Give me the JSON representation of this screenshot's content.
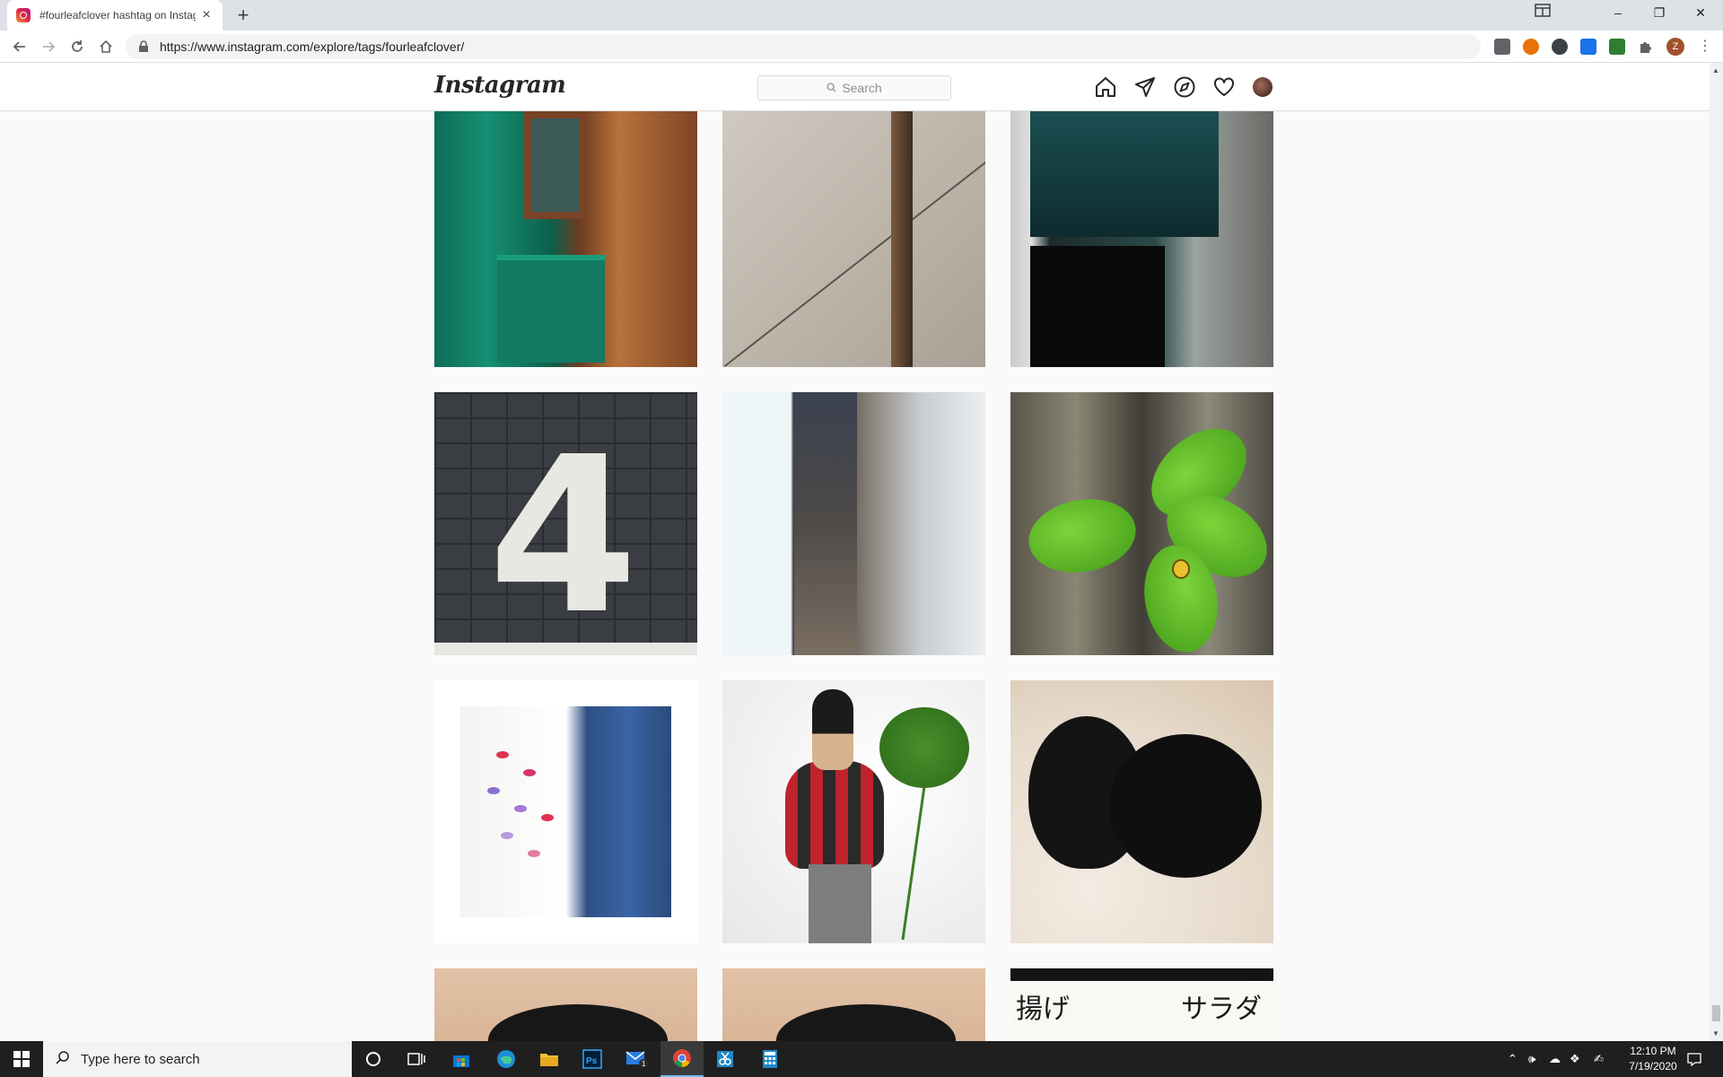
{
  "browser": {
    "tab_title": "#fourleafclover hashtag on Instagram",
    "tab_close": "×",
    "new_tab": "+",
    "url": "https://www.instagram.com/explore/tags/fourleafclover/",
    "profile_initial": "Z",
    "window": {
      "minimize": "–",
      "restore": "❐",
      "close": "✕"
    },
    "extension_colors": [
      "#5f6368",
      "#e8710a",
      "#3c4043",
      "#1a73e8",
      "#2e7d32"
    ]
  },
  "instagram": {
    "logo": "Instagram",
    "search_placeholder": "Search",
    "nav_icons": [
      "home-icon",
      "direct-icon",
      "explore-icon",
      "activity-icon",
      "profile-avatar"
    ]
  },
  "grid": {
    "tiles": [
      {
        "name": "green-door-photo"
      },
      {
        "name": "concrete-corner-photo"
      },
      {
        "name": "glass-building-photo"
      },
      {
        "name": "painted-number-photo",
        "text": "4"
      },
      {
        "name": "building-facade-photo"
      },
      {
        "name": "clover-ladybug-photo"
      },
      {
        "name": "clothes-hanger-photo"
      },
      {
        "name": "figurine-clover-photo"
      },
      {
        "name": "black-cats-photo"
      },
      {
        "name": "black-cat-photo-1"
      },
      {
        "name": "black-cat-photo-2"
      },
      {
        "name": "japanese-menu-photo",
        "text_left": "揚げ",
        "text_right": "サラダ"
      }
    ]
  },
  "taskbar": {
    "search_placeholder": "Type here to search",
    "mail_badge": "1",
    "time": "12:10 PM",
    "date": "7/19/2020"
  }
}
